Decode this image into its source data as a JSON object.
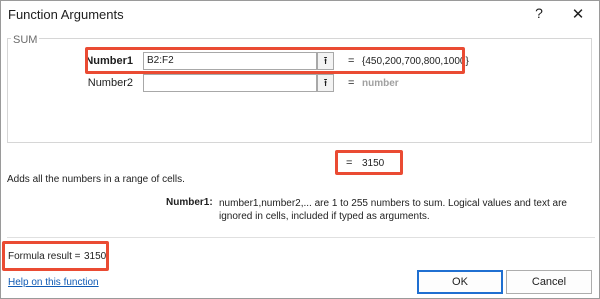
{
  "window": {
    "title": "Function Arguments",
    "help_glyph": "?",
    "close_glyph": "✕"
  },
  "function": {
    "name": "SUM",
    "args": [
      {
        "label": "Number1",
        "value": "B2:F2",
        "evaluated": "{450,200,700,800,1000}"
      },
      {
        "label": "Number2",
        "value": "",
        "evaluated": "number"
      }
    ],
    "eq_sign": "=",
    "total_value": "3150",
    "description": "Adds all the numbers in a range of cells.",
    "arg_help_label": "Number1:",
    "arg_help_text": "number1,number2,... are 1 to 255 numbers to sum. Logical values and text are ignored in cells, included if typed as arguments."
  },
  "result": {
    "label": "Formula result =",
    "value": "3150"
  },
  "footer": {
    "help_link": "Help on this function",
    "ok_label": "OK",
    "cancel_label": "Cancel"
  },
  "icons": {
    "collapse": "⭱"
  },
  "colors": {
    "highlight": "#ea4b33",
    "link": "#0f5ab4",
    "primary_border": "#1f6fd1"
  }
}
